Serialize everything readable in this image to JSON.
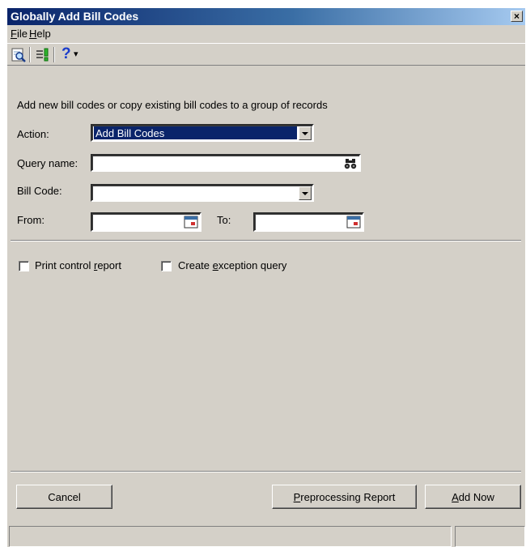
{
  "window": {
    "title": "Globally Add Bill Codes",
    "close_glyph": "×"
  },
  "menu": {
    "items": [
      {
        "label": "File",
        "mnemonic": "F"
      },
      {
        "label": "Help",
        "mnemonic": "H"
      }
    ]
  },
  "toolbar": {
    "icons": [
      "preview-icon",
      "query-tool-icon",
      "help-question-icon",
      "dropdown-arrow-icon"
    ],
    "help_glyph": "?",
    "help_arrow": "▾"
  },
  "form": {
    "description": "Add new bill codes or copy existing bill codes to a group of records",
    "action_label": "Action:",
    "action_value": "Add Bill Codes",
    "query_label": "Query name:",
    "query_value": "",
    "bill_code_label": "Bill Code:",
    "bill_code_value": "",
    "from_label": "From:",
    "from_value": "",
    "to_label": "To:",
    "to_value": ""
  },
  "options": {
    "print_control_report": {
      "label_pre": "Print control ",
      "mnemonic": "r",
      "label_post": "eport",
      "checked": false
    },
    "create_exception_query": {
      "label_pre": "Create ",
      "mnemonic": "e",
      "label_post": "xception query",
      "checked": false
    }
  },
  "buttons": {
    "cancel": "Cancel",
    "preprocess": {
      "mnemonic": "P",
      "rest": "reprocessing Report"
    },
    "add_now": {
      "mnemonic": "A",
      "rest": "dd Now"
    }
  },
  "colors": {
    "title_start": "#0a246a",
    "title_end": "#a6caf0",
    "dialog_bg": "#d4d0c8",
    "selection": "#0a246a"
  }
}
